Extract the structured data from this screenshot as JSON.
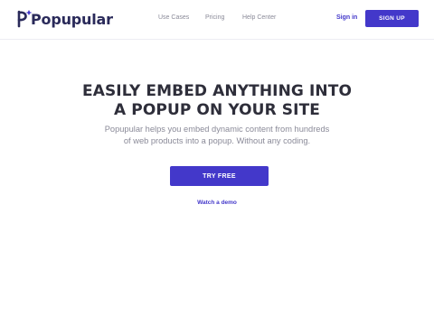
{
  "brand": {
    "name": "Popupular",
    "accent": "#4338ca"
  },
  "nav": {
    "items": [
      {
        "label": "Use Cases"
      },
      {
        "label": "Pricing"
      },
      {
        "label": "Help Center"
      }
    ],
    "signin_label": "Sign in",
    "signup_label": "SIGN UP"
  },
  "hero": {
    "title_line1": "EASILY EMBED ANYTHING INTO",
    "title_line2": "A POPUP ON YOUR SITE",
    "subtitle_line1": "Popupular helps you embed dynamic content from hundreds",
    "subtitle_line2": "of web products into a popup. Without any coding.",
    "cta_label": "TRY FREE",
    "demo_label": "Watch a demo"
  }
}
